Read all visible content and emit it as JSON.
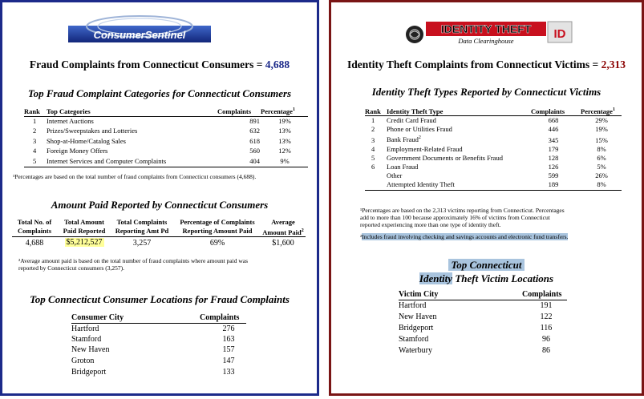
{
  "left": {
    "logo_text": "ConsumerSentinel",
    "title_prefix": "Fraud Complaints from Connecticut Consumers = ",
    "title_total": "4,688",
    "categories": {
      "heading": "Top Fraud Complaint Categories for Connecticut Consumers",
      "col_rank": "Rank",
      "col_category": "Top Categories",
      "col_complaints": "Complaints",
      "col_percentage": "Percentage",
      "col_percentage_sup": "1",
      "rows": [
        {
          "rank": "1",
          "category": "Internet Auctions",
          "complaints": "891",
          "percentage": "19%"
        },
        {
          "rank": "2",
          "category": "Prizes/Sweepstakes and Lotteries",
          "complaints": "632",
          "percentage": "13%"
        },
        {
          "rank": "3",
          "category": "Shop-at-Home/Catalog Sales",
          "complaints": "618",
          "percentage": "13%"
        },
        {
          "rank": "4",
          "category": "Foreign Money Offers",
          "complaints": "560",
          "percentage": "12%"
        },
        {
          "rank": "5",
          "category": "Internet Services and Computer Complaints",
          "complaints": "404",
          "percentage": "9%"
        }
      ],
      "footnote": "¹Percentages are based on the total number of fraud complaints from Connecticut consumers (4,688)."
    },
    "amount": {
      "heading": "Amount Paid Reported by Connecticut Consumers",
      "col1_l1": "Total No. of",
      "col1_l2": "Complaints",
      "col2_l1": "Total Amount",
      "col2_l2": "Paid Reported",
      "col3_l1": "Total Complaints",
      "col3_l2": "Reporting Amt Pd",
      "col4_l1": "Percentage of Complaints",
      "col4_l2": "Reporting Amount Paid",
      "col5_l1": "Average",
      "col5_l2": "Amount Paid",
      "col5_sup": "2",
      "v1": "4,688",
      "v2": "$5,212,527",
      "v3": "3,257",
      "v4": "69%",
      "v5": "$1,600",
      "footnote_l1": "²Average amount paid is based on the total number of fraud complaints where amount paid was",
      "footnote_l2": "reported by Connecticut consumers (3,257)."
    },
    "locations": {
      "heading": "Top Connecticut Consumer Locations for Fraud Complaints",
      "col_city": "Consumer City",
      "col_complaints": "Complaints",
      "rows": [
        {
          "city": "Hartford",
          "complaints": "276"
        },
        {
          "city": "Stamford",
          "complaints": "163"
        },
        {
          "city": "New Haven",
          "complaints": "157"
        },
        {
          "city": "Groton",
          "complaints": "147"
        },
        {
          "city": "Bridgeport",
          "complaints": "133"
        }
      ]
    }
  },
  "right": {
    "logo_text": "IDENTITY THEFT",
    "logo_sub": "Data Clearinghouse",
    "logo_badge": "ID",
    "title_prefix": "Identity Theft Complaints from Connecticut Victims = ",
    "title_total": "2,313",
    "types": {
      "heading": "Identity Theft Types Reported by Connecticut Victims",
      "col_rank": "Rank",
      "col_type": "Identity Theft Type",
      "col_complaints": "Complaints",
      "col_percentage": "Percentage",
      "col_percentage_sup": "1",
      "rows": [
        {
          "rank": "1",
          "type": "Credit Card Fraud",
          "sup": "",
          "complaints": "668",
          "percentage": "29%"
        },
        {
          "rank": "2",
          "type": "Phone or Utilities Fraud",
          "sup": "",
          "complaints": "446",
          "percentage": "19%"
        },
        {
          "rank": "3",
          "type": "Bank Fraud",
          "sup": "2",
          "complaints": "345",
          "percentage": "15%"
        },
        {
          "rank": "4",
          "type": "Employment-Related Fraud",
          "sup": "",
          "complaints": "179",
          "percentage": "8%"
        },
        {
          "rank": "5",
          "type": "Government Documents or Benefits Fraud",
          "sup": "",
          "complaints": "128",
          "percentage": "6%"
        },
        {
          "rank": "6",
          "type": "Loan Fraud",
          "sup": "",
          "complaints": "126",
          "percentage": "5%"
        },
        {
          "rank": "",
          "type": "Other",
          "sup": "",
          "complaints": "599",
          "percentage": "26%"
        },
        {
          "rank": "",
          "type": "Attempted Identity Theft",
          "sup": "",
          "complaints": "189",
          "percentage": "8%"
        }
      ],
      "footnote1_l1": "¹Percentages are based on the 2,313 victims reporting from Connecticut.  Percentages",
      "footnote1_l2": "add to more than 100 because approximately 16% of victims from Connecticut",
      "footnote1_l3": "reported experiencing more than one type of identity theft.",
      "footnote2_prefix": "²",
      "footnote2_text": "Includes fraud involving checking and savings accounts and electronic fund transfers."
    },
    "locations": {
      "heading_l1": "Top Connecticut",
      "heading_l2a": "Identity",
      "heading_l2b": " Theft Victim Locations",
      "col_city": "Victim City",
      "col_complaints": "Complaints",
      "rows": [
        {
          "city": "Hartford",
          "complaints": "191"
        },
        {
          "city": "New Haven",
          "complaints": "122"
        },
        {
          "city": "Bridgeport",
          "complaints": "116"
        },
        {
          "city": "Stamford",
          "complaints": "96"
        },
        {
          "city": "Waterbury",
          "complaints": "86"
        }
      ]
    }
  },
  "colors": {
    "left_border": "#1c2a8a",
    "right_border": "#7a1515",
    "left_total": "#1c2a8a",
    "right_total": "#8b0000",
    "highlight_yellow": "#ffff99",
    "highlight_blue": "#a9c4de"
  }
}
